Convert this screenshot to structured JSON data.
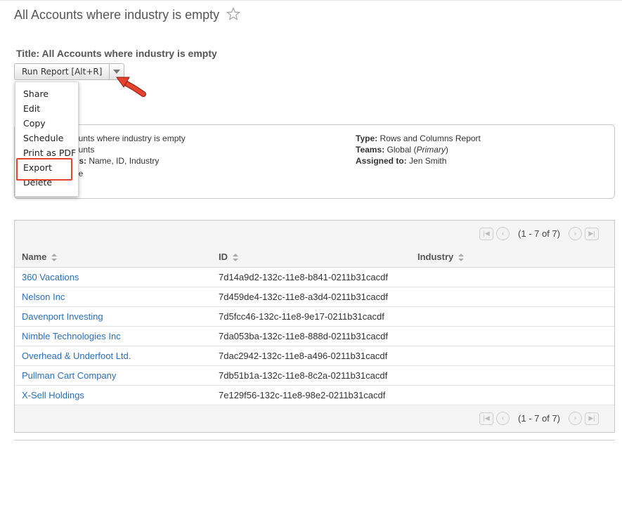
{
  "page": {
    "title": "All Accounts where industry is empty",
    "report_title_label": "Title: All Accounts where industry is empty"
  },
  "toolbar": {
    "run_report_label": "Run Report [Alt+R]"
  },
  "menu": {
    "items": [
      {
        "label": "Share"
      },
      {
        "label": "Edit"
      },
      {
        "label": "Copy"
      },
      {
        "label": "Schedule"
      },
      {
        "label": "Print as PDF"
      },
      {
        "label": "Export"
      },
      {
        "label": "Delete"
      }
    ],
    "highlighted": "Export"
  },
  "details": {
    "left": {
      "name_fragment": "ounts where industry is empty",
      "module_fragment": "ounts",
      "columns_label": "ns:",
      "columns_value": "Name, ID, Industry",
      "chart_fragment": "ne"
    },
    "right": {
      "type_label": "Type:",
      "type_value": "Rows and Columns Report",
      "teams_label": "Teams:",
      "teams_value": "Global",
      "teams_primary": "Primary",
      "assigned_label": "Assigned to:",
      "assigned_value": "Jen Smith"
    }
  },
  "pager": {
    "text": "(1 - 7 of 7)"
  },
  "table": {
    "headers": {
      "name": "Name",
      "id": "ID",
      "industry": "Industry"
    },
    "rows": [
      {
        "name": "360 Vacations",
        "id": "7d14a9d2-132c-11e8-b841-0211b31cacdf",
        "industry": ""
      },
      {
        "name": "Nelson Inc",
        "id": "7d459de4-132c-11e8-a3d4-0211b31cacdf",
        "industry": ""
      },
      {
        "name": "Davenport Investing",
        "id": "7d5fcc46-132c-11e8-9e17-0211b31cacdf",
        "industry": ""
      },
      {
        "name": "Nimble Technologies Inc",
        "id": "7da053ba-132c-11e8-888d-0211b31cacdf",
        "industry": ""
      },
      {
        "name": "Overhead & Underfoot Ltd.",
        "id": "7dac2942-132c-11e8-a496-0211b31cacdf",
        "industry": ""
      },
      {
        "name": "Pullman Cart Company",
        "id": "7db51b1a-132c-11e8-8c2a-0211b31cacdf",
        "industry": ""
      },
      {
        "name": "X-Sell Holdings",
        "id": "7e129f56-132c-11e8-98e2-0211b31cacdf",
        "industry": ""
      }
    ]
  },
  "colors": {
    "link": "#2a6ebb",
    "highlight": "#e8412d",
    "arrow": "#e8412d"
  }
}
